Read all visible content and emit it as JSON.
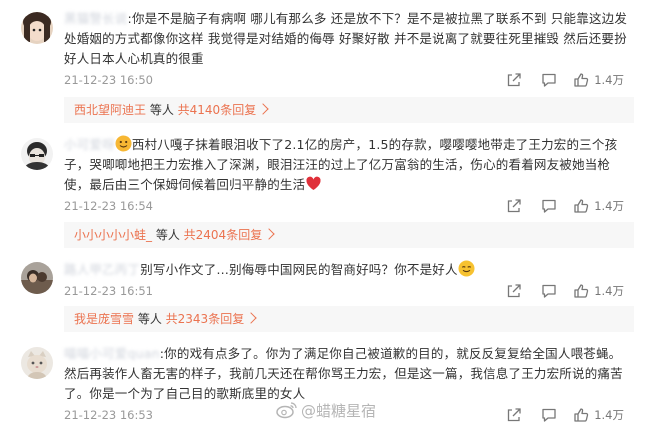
{
  "comments": [
    {
      "username": "黑猫警长说",
      "text": "你是不是脑子有病啊 哪儿有那么多 还是放不下？是不是被拉黑了联系不到 只能靠这边发 处婚姻的方式都像你这样 我觉得是对结婚的侮辱 好聚好散 并不是说离了就要往死里摧毁 然后还要扮好人日本人心机真的很重",
      "time": "21-12-23 16:50",
      "likes": "1.4万",
      "reply": {
        "user": "西北望阿迪王",
        "middle": " 等人 ",
        "count": "共4140条回复"
      }
    },
    {
      "username": "小可爱呀",
      "text": "西村八嘎子抹着眼泪收下了2.1亿的房产，1.5的存款，嘤嘤嘤地带走了王力宏的三个孩子，哭唧唧地把王力宏推入了深渊，眼泪汪汪的过上了亿万富翁的生活，伤心的看着网友被她当枪使，最后由三个保姆伺候着回归平静的生活",
      "time": "21-12-23 16:54",
      "likes": "1.4万",
      "reply": {
        "user": "小小小小小蛙_",
        "middle": " 等人 ",
        "count": "共2404条回复"
      }
    },
    {
      "username": "路人甲乙丙丁",
      "text": "别写小作文了…别侮辱中国网民的智商好吗？你不是好人",
      "time": "21-12-23 16:51",
      "likes": "1.4万",
      "reply": {
        "user": "我是庞雪雪",
        "middle": " 等人 ",
        "count": "共2343条回复"
      }
    },
    {
      "username": "喵喵小可爱quan",
      "text": "你的戏有点多了。你为了满足你自己被道歉的目的，就反反复复给全国人喂苍蝇。然后再装作人畜无害的样子，我前几天还在帮你骂王力宏，但是这一篇，我信息了王力宏所说的痛苦了。你是一个为了自己目的歌斯底里的女人",
      "time": "21-12-23 16:53",
      "likes": "1.4万"
    }
  ],
  "watermark": "@蜡糖星宿",
  "icons": {
    "share": "share-icon",
    "comment": "comment-icon",
    "like": "thumbs-up-icon"
  },
  "colors": {
    "accent": "#eb7350",
    "heart": "#e0303a"
  }
}
